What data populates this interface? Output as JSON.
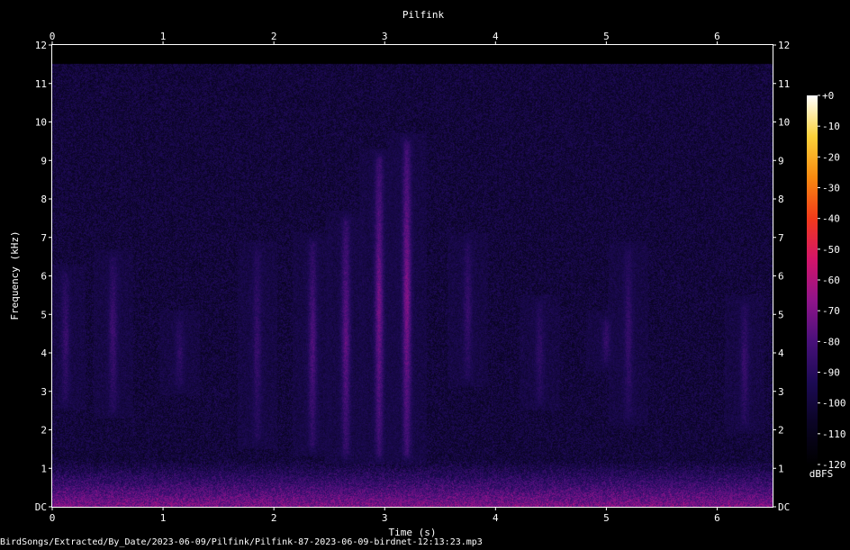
{
  "filename": "BirdSongs/Extracted/By_Date/2023-06-09/Pilfink/Pilfink-87-2023-06-09-birdnet-12:13:23.mp3",
  "chart_data": {
    "type": "heatmap",
    "title": "Pilfink",
    "xlabel": "Time (s)",
    "ylabel": "Frequency (kHz)",
    "xlim": [
      0,
      6.5
    ],
    "ylim": [
      0,
      12
    ],
    "x_ticks": [
      {
        "value": 0,
        "label": "0"
      },
      {
        "value": 1,
        "label": "1"
      },
      {
        "value": 2,
        "label": "2"
      },
      {
        "value": 3,
        "label": "3"
      },
      {
        "value": 4,
        "label": "4"
      },
      {
        "value": 5,
        "label": "5"
      },
      {
        "value": 6,
        "label": "6"
      }
    ],
    "y_ticks": [
      {
        "value": 0,
        "label": "DC"
      },
      {
        "value": 1,
        "label": "1"
      },
      {
        "value": 2,
        "label": "2"
      },
      {
        "value": 3,
        "label": "3"
      },
      {
        "value": 4,
        "label": "4"
      },
      {
        "value": 5,
        "label": "5"
      },
      {
        "value": 6,
        "label": "6"
      },
      {
        "value": 7,
        "label": "7"
      },
      {
        "value": 8,
        "label": "8"
      },
      {
        "value": 9,
        "label": "9"
      },
      {
        "value": 10,
        "label": "10"
      },
      {
        "value": 11,
        "label": "11"
      },
      {
        "value": 12,
        "label": "12"
      }
    ],
    "colorbar": {
      "label": "dBFS",
      "range": [
        -120,
        0
      ],
      "ticks": [
        {
          "value": 0,
          "label": "+0"
        },
        {
          "value": -10,
          "label": "-10"
        },
        {
          "value": -20,
          "label": "-20"
        },
        {
          "value": -30,
          "label": "-30"
        },
        {
          "value": -40,
          "label": "-40"
        },
        {
          "value": -50,
          "label": "-50"
        },
        {
          "value": -60,
          "label": "-60"
        },
        {
          "value": -70,
          "label": "-70"
        },
        {
          "value": -80,
          "label": "-80"
        },
        {
          "value": -90,
          "label": "-90"
        },
        {
          "value": -100,
          "label": "-100"
        },
        {
          "value": -110,
          "label": "-110"
        },
        {
          "value": -120,
          "label": "-120"
        }
      ],
      "colormap": [
        "#000000",
        "#0a0424",
        "#1c0a54",
        "#48107a",
        "#90148a",
        "#d4146a",
        "#f23a1a",
        "#f88a10",
        "#fcd23a",
        "#ffffff"
      ]
    },
    "content_top_khz": 11.5,
    "background_level_db": -100,
    "low_band": {
      "from_khz": 0,
      "to_khz": 1.2,
      "peak_db": -70
    },
    "events": [
      {
        "t": 0.12,
        "f_lo": 2.8,
        "f_hi": 6.0,
        "db": -86
      },
      {
        "t": 0.55,
        "f_lo": 2.6,
        "f_hi": 6.4,
        "db": -84
      },
      {
        "t": 1.15,
        "f_lo": 3.2,
        "f_hi": 4.8,
        "db": -88
      },
      {
        "t": 1.85,
        "f_lo": 1.8,
        "f_hi": 6.6,
        "db": -86
      },
      {
        "t": 2.35,
        "f_lo": 1.6,
        "f_hi": 6.8,
        "db": -80
      },
      {
        "t": 2.65,
        "f_lo": 1.4,
        "f_hi": 7.4,
        "db": -76
      },
      {
        "t": 2.95,
        "f_lo": 1.4,
        "f_hi": 9.0,
        "db": -72
      },
      {
        "t": 3.2,
        "f_lo": 1.4,
        "f_hi": 9.4,
        "db": -70
      },
      {
        "t": 3.75,
        "f_lo": 3.4,
        "f_hi": 6.8,
        "db": -86
      },
      {
        "t": 4.4,
        "f_lo": 2.8,
        "f_hi": 5.2,
        "db": -88
      },
      {
        "t": 5.0,
        "f_lo": 3.8,
        "f_hi": 4.8,
        "db": -86
      },
      {
        "t": 5.2,
        "f_lo": 2.4,
        "f_hi": 6.6,
        "db": -86
      },
      {
        "t": 6.25,
        "f_lo": 2.2,
        "f_hi": 5.2,
        "db": -86
      }
    ]
  }
}
